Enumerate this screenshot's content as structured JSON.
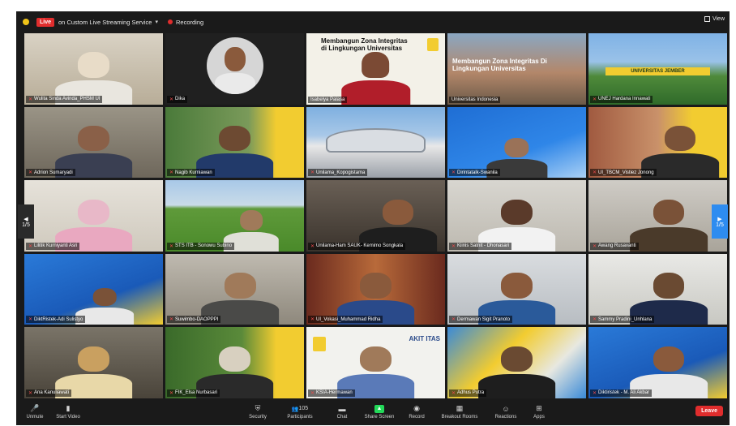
{
  "topbar": {
    "live_badge": "Live",
    "stream_label": "on Custom Live Streaming Service",
    "caret": "▾",
    "recording_label": "Recording",
    "view_label": "View"
  },
  "tiles": [
    {
      "name": "Wulita Sinda Avinda_PHSM Ul",
      "muted": true
    },
    {
      "name": "Dika",
      "muted": true
    },
    {
      "name": "Isabelya Palasa",
      "muted": false,
      "active": true,
      "slide": "Membangun Zona Integritas di Lingkungan Universitas"
    },
    {
      "name": "Universitas Indonesia",
      "muted": false,
      "slide": "Membangun Zona Integritas Di Lingkungan Universitas"
    },
    {
      "name": "UNEJ Hardana Innawati",
      "muted": true,
      "banner": "UNIVERSITAS JEMBER"
    },
    {
      "name": "Adrion Sumaryadi",
      "muted": true
    },
    {
      "name": "Nagib Kurniawan",
      "muted": true
    },
    {
      "name": "Unilama_Kopogistama",
      "muted": true
    },
    {
      "name": "Dirintatalk-Swanila",
      "muted": true
    },
    {
      "name": "UI_TBCM_Vistiez Jonong",
      "muted": true
    },
    {
      "name": "Lilitik Kurniyanti Asri",
      "muted": true
    },
    {
      "name": "STS ITB - Sonowu Subino",
      "muted": true
    },
    {
      "name": "Unilama-Ham SAUK- Kemimo Songkala",
      "muted": true
    },
    {
      "name": "Kiinis Satnit - Dhonasari",
      "muted": true
    },
    {
      "name": "Awang Rusavanti",
      "muted": true
    },
    {
      "name": "DiktRistek-Adi Sulistyo",
      "muted": true
    },
    {
      "name": "Suwimbo-DAOPPPI",
      "muted": true
    },
    {
      "name": "UI_Vokasi_Muhammad Ridha",
      "muted": true
    },
    {
      "name": "Dermawan Sigit Pranoto",
      "muted": true
    },
    {
      "name": "Sammy Pradini_Unhlana",
      "muted": true
    },
    {
      "name": "Ana Kanuliawati",
      "muted": true
    },
    {
      "name": "FIK_Elsa Nurbasari",
      "muted": true
    },
    {
      "name": "KSIA-Hermawan",
      "muted": true,
      "slide": "AKIT ITAS"
    },
    {
      "name": "Adhus Putra",
      "muted": true
    },
    {
      "name": "Diktiristek - M. Ali Akbar",
      "muted": true
    }
  ],
  "nav": {
    "left_page": "1/5",
    "right_page": "1/5"
  },
  "toolbar": {
    "items": [
      {
        "label": "Unmute",
        "icon": "microphone-icon"
      },
      {
        "label": "Start Video",
        "icon": "video-icon"
      },
      {
        "label": "Security",
        "icon": "shield-icon"
      },
      {
        "label": "Participants",
        "icon": "participants-icon",
        "count": "105"
      },
      {
        "label": "Chat",
        "icon": "chat-icon"
      },
      {
        "label": "Share Screen",
        "icon": "share-screen-icon"
      },
      {
        "label": "Record",
        "icon": "record-icon"
      },
      {
        "label": "Breakout Rooms",
        "icon": "breakout-rooms-icon"
      },
      {
        "label": "Reactions",
        "icon": "reactions-icon"
      },
      {
        "label": "Apps",
        "icon": "apps-icon"
      }
    ],
    "leave_label": "Leave"
  },
  "colors": {
    "accent_yellow": "#f2cc30",
    "live_red": "#e02d2d",
    "share_green": "#23d959",
    "nav_blue": "#2e8cf0"
  }
}
